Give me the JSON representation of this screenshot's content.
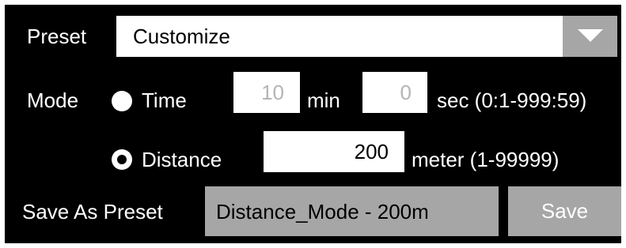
{
  "preset": {
    "label": "Preset",
    "selected": "Customize",
    "dropdown_icon": "triangle-down-icon"
  },
  "mode": {
    "label": "Mode",
    "time": {
      "option_label": "Time",
      "selected": false,
      "minutes_value": "10",
      "minutes_unit": "min",
      "seconds_value": "0",
      "seconds_unit": "sec (0:1-999:59)"
    },
    "distance": {
      "option_label": "Distance",
      "selected": true,
      "value": "200",
      "unit": "meter (1-99999)"
    }
  },
  "save_preset": {
    "label": "Save As Preset",
    "name_value": "Distance_Mode - 200m",
    "save_button": "Save"
  },
  "colors": {
    "background": "#000000",
    "field": "#ffffff",
    "disabled_field": "#a6a6a6",
    "disabled_text": "#b5b5b5"
  }
}
